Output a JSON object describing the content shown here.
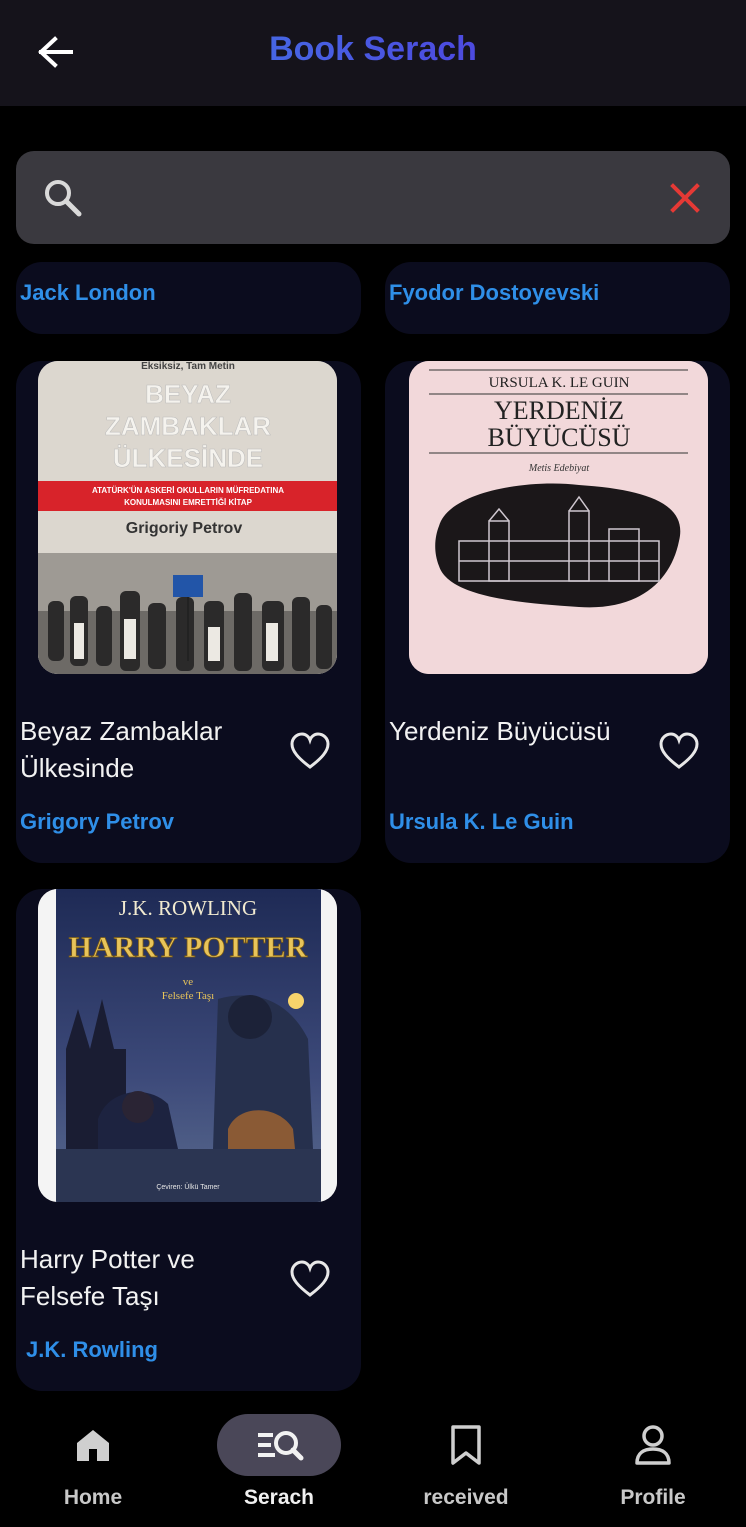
{
  "header": {
    "title": "Book Serach",
    "back_icon": "arrow-left-icon"
  },
  "search": {
    "value": "",
    "placeholder": "",
    "search_icon": "search-icon",
    "clear_icon": "close-icon",
    "clear_color": "#e53935"
  },
  "partial_cards": [
    {
      "author": "Jack London"
    },
    {
      "author": "Fyodor Dostoyevski"
    }
  ],
  "books": [
    {
      "title": "Beyaz Zambaklar Ülkesinde",
      "author": "Grigory Petrov",
      "cover": {
        "top_line": "Eksiksiz, Tam Metin",
        "title_lines": [
          "BEYAZ",
          "ZAMBAKLAR",
          "ÜLKESİNDE"
        ],
        "banner_lines": [
          "ATATÜRK'ÜN ASKERİ OKULLARIN MÜFREDATINA",
          "KONULMASINI EMRETTİĞİ KİTAP"
        ],
        "author": "Grigoriy Petrov"
      }
    },
    {
      "title": "Yerdeniz Büyücüsü",
      "author": "Ursula K. Le Guin",
      "cover": {
        "author": "URSULA K. LE GUIN",
        "title_lines": [
          "YERDENİZ",
          "BÜYÜCÜSÜ"
        ],
        "publisher": "Metis Edebiyat"
      }
    },
    {
      "title": "Harry Potter ve Felsefe Taşı",
      "author": "J.K. Rowling",
      "cover": {
        "author": "J.K. ROWLING",
        "title": "HARRY POTTER",
        "subtitle_lines": [
          "ve",
          "Felsefe Taşı"
        ],
        "translator": "Çeviren: Ülkü Tamer"
      }
    }
  ],
  "nav": {
    "items": [
      {
        "label": "Home",
        "icon": "home-icon"
      },
      {
        "label": "Serach",
        "icon": "search-list-icon",
        "active": true
      },
      {
        "label": "received",
        "icon": "bookmark-icon"
      },
      {
        "label": "Profile",
        "icon": "person-icon"
      }
    ]
  },
  "colors": {
    "accent": "#2f8fe8",
    "card_bg": "#0b0c1e",
    "app_bar": "#15131b",
    "search_bg": "#3a393f",
    "active_pill": "#4a4758"
  }
}
